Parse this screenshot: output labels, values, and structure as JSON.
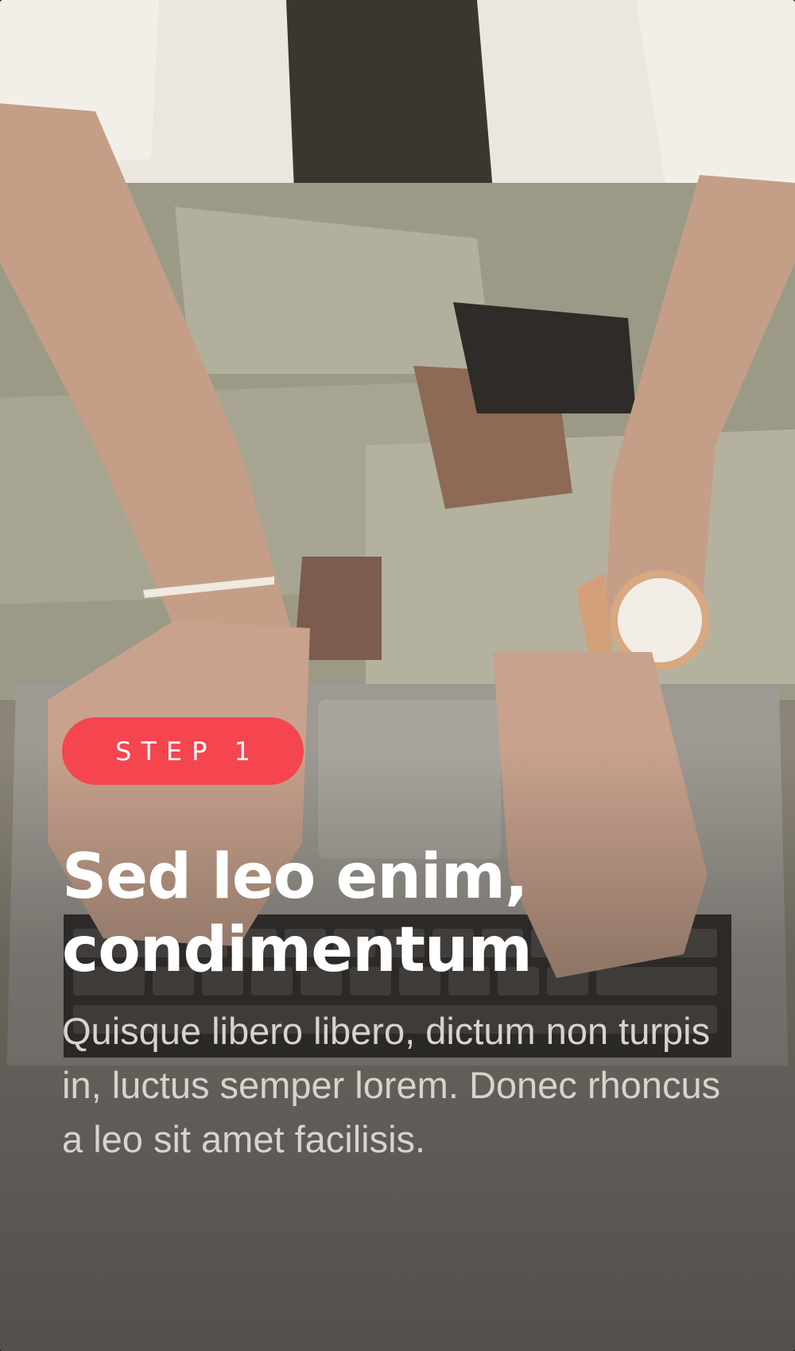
{
  "onboarding": {
    "step_label": "STEP 1",
    "headline": "Sed leo enim, condimentum",
    "body": "Quisque libero libero, dictum non turpis in, luctus semper lorem. Donec rhoncus a leo sit amet facilisis."
  },
  "colors": {
    "badge": "#f5454f",
    "headline": "#ffffff",
    "body": "#d7d3cd"
  }
}
